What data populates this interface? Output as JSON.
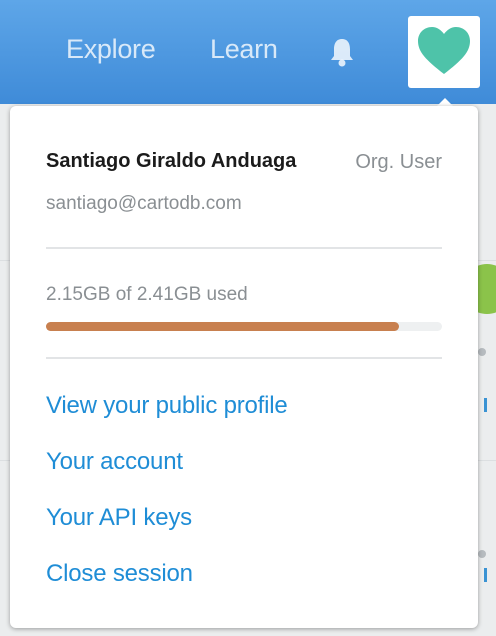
{
  "header": {
    "nav": [
      {
        "label": "Explore"
      },
      {
        "label": "Learn"
      }
    ],
    "notifications_icon": "bell-icon",
    "avatar_icon": "heart-icon",
    "colors": {
      "bar": "#4a96df",
      "heart": "#4ec3a9"
    }
  },
  "user_menu": {
    "name": "Santiago Giraldo Anduaga",
    "role": "Org. User",
    "email": "santiago@cartodb.com",
    "storage": {
      "text": "2.15GB of 2.41GB used",
      "used_gb": 2.15,
      "total_gb": 2.41,
      "bar_color": "#c8804f"
    },
    "links": [
      {
        "label": "View your public profile"
      },
      {
        "label": "Your account"
      },
      {
        "label": "Your API keys"
      },
      {
        "label": "Close session"
      }
    ],
    "link_color": "#1f8dd6"
  }
}
